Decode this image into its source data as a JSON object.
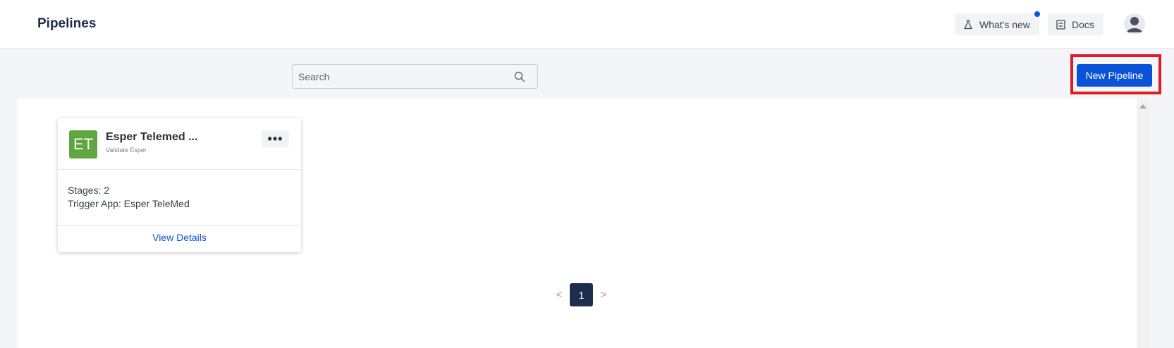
{
  "header": {
    "title": "Pipelines",
    "whats_new_label": "What's new",
    "docs_label": "Docs",
    "whats_new_icon": "flask-icon",
    "docs_icon": "docs-icon",
    "avatar_icon": "user-avatar-icon"
  },
  "toolbar": {
    "search_placeholder": "Search",
    "search_value": "",
    "new_pipeline_label": "New Pipeline"
  },
  "pipelines": [
    {
      "logo_initials": "ET",
      "logo_color": "#5fa640",
      "name": "Esper Telemed ...",
      "description": "Validate Esper",
      "stages": "Stages: 2",
      "trigger_app": "Trigger App: Esper TeleMed",
      "view_details_label": "View Details"
    }
  ],
  "pagination": {
    "prev": "<",
    "current_page": "1",
    "next": ">"
  },
  "colors": {
    "accent": "#0a53d6",
    "highlight": "#e01b24",
    "active_page": "#1f2d4d"
  }
}
